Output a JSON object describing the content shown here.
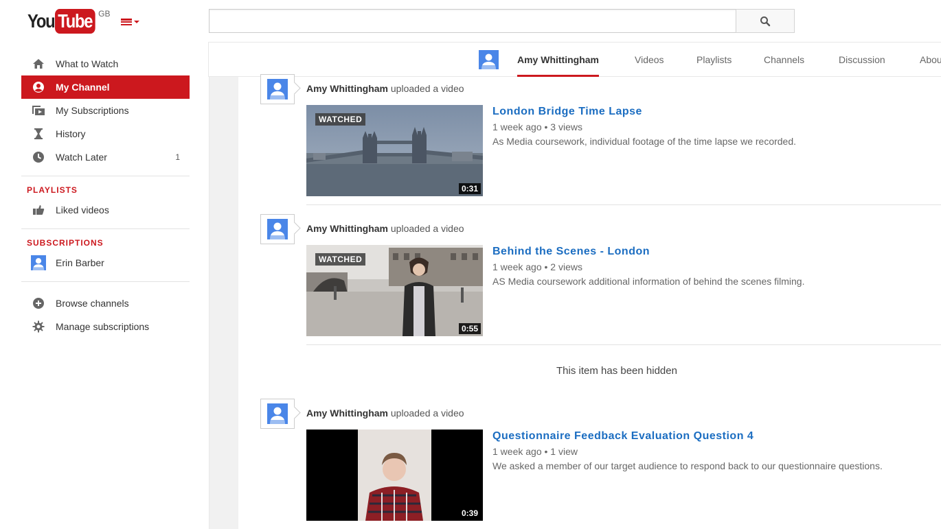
{
  "header": {
    "logo_you": "You",
    "logo_tube": "Tube",
    "logo_region": "GB",
    "search_placeholder": ""
  },
  "sidebar": {
    "items": [
      {
        "label": "What to Watch",
        "icon": "home-icon"
      },
      {
        "label": "My Channel",
        "icon": "user-circle-icon",
        "active": true
      },
      {
        "label": "My Subscriptions",
        "icon": "subscriptions-icon"
      },
      {
        "label": "History",
        "icon": "hourglass-icon"
      },
      {
        "label": "Watch Later",
        "icon": "clock-icon",
        "count": "1"
      }
    ],
    "playlists_title": "PLAYLISTS",
    "playlists": [
      {
        "label": "Liked videos",
        "icon": "thumbs-up-icon"
      }
    ],
    "subscriptions_title": "SUBSCRIPTIONS",
    "subscriptions": [
      {
        "label": "Erin Barber",
        "icon": "avatar-icon"
      }
    ],
    "footer": [
      {
        "label": "Browse channels",
        "icon": "plus-circle-icon"
      },
      {
        "label": "Manage subscriptions",
        "icon": "gear-icon"
      }
    ]
  },
  "channel": {
    "name": "Amy Whittingham",
    "tabs": [
      "Videos",
      "Playlists",
      "Channels",
      "Discussion",
      "About"
    ]
  },
  "feed": {
    "uploaded_text": "uploaded a video",
    "hidden_message": "This item has been hidden",
    "items": [
      {
        "author": "Amy Whittingham",
        "title": "London Bridge Time Lapse",
        "age": "1 week ago",
        "views": "3 views",
        "description": "As Media coursework, individual footage of the time lapse we recorded.",
        "duration": "0:31",
        "watched": "WATCHED"
      },
      {
        "author": "Amy Whittingham",
        "title": "Behind the Scenes - London",
        "age": "1 week ago",
        "views": "2 views",
        "description": "AS Media coursework additional information of behind the scenes filming.",
        "duration": "0:55",
        "watched": "WATCHED"
      },
      {
        "author": "Amy Whittingham",
        "title": "Questionnaire Feedback Evaluation Question 4",
        "age": "1 week ago",
        "views": "1 view",
        "description": "We asked a member of our target audience to respond back to our questionnaire questions.",
        "duration": "0:39"
      }
    ]
  },
  "colors": {
    "brand_red": "#cc181e",
    "link_blue": "#1b6dc1",
    "avatar_blue": "#4a86e8"
  }
}
